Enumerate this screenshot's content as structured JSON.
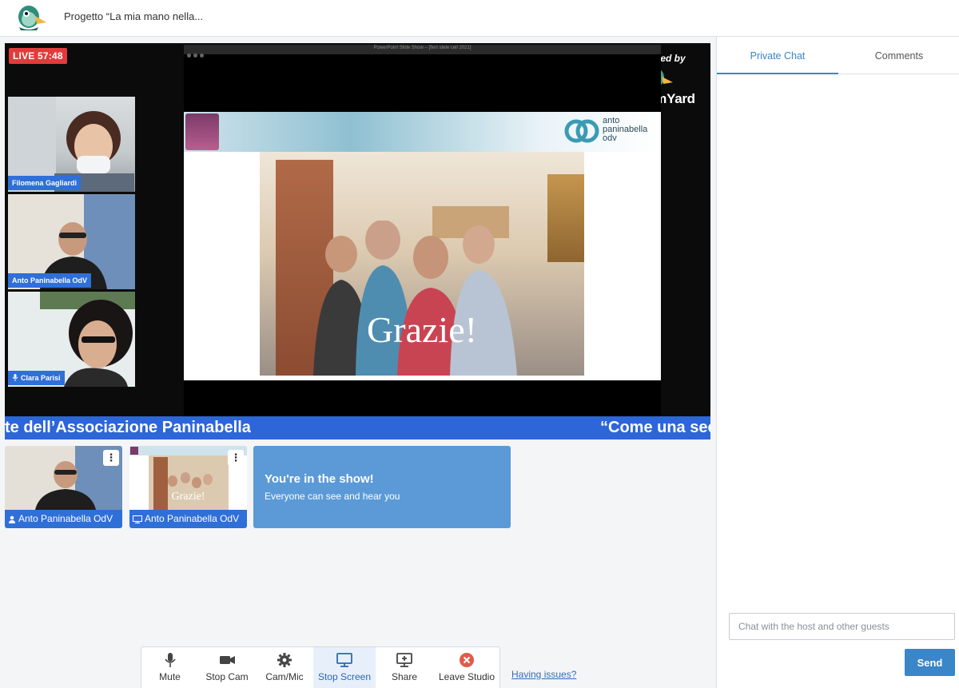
{
  "header": {
    "project_title": "Progetto “La mia mano nella..."
  },
  "stage": {
    "live_badge": "LIVE 57:48",
    "powered_by": "Powered by",
    "brand": "StreamYard",
    "shared_window_title": "PowerPoint Slide Show – [fieri stele cell 2021]",
    "guests": [
      {
        "name": "Filomena Gagliardi"
      },
      {
        "name": "Anto Paninabella OdV"
      },
      {
        "name": "Clara Parisi"
      }
    ],
    "slide": {
      "logo_text": [
        "anto",
        "paninabella",
        "odv"
      ],
      "caption": "Grazie!"
    },
    "ticker": {
      "part1": "te dell’Associazione Paninabella",
      "part2": "“Come una sec"
    }
  },
  "thumbnails": [
    {
      "name": "Anto Paninabella OdV",
      "type": "camera",
      "more_icon": "⋮"
    },
    {
      "name": "Anto Paninabella OdV",
      "type": "screen",
      "more_icon": "⋮",
      "preview_caption": "Grazie!"
    }
  ],
  "show_card": {
    "title": "You're in the show!",
    "subtitle": "Everyone can see and hear you"
  },
  "controls": [
    {
      "label": "Mute",
      "icon": "mic-icon"
    },
    {
      "label": "Stop Cam",
      "icon": "camera-icon"
    },
    {
      "label": "Cam/Mic",
      "icon": "gear-icon"
    },
    {
      "label": "Stop Screen",
      "icon": "monitor-icon",
      "active": true
    },
    {
      "label": "Share",
      "icon": "share-screen-icon"
    },
    {
      "label": "Leave Studio",
      "icon": "close-circle-icon"
    }
  ],
  "having_issues": "Having issues?",
  "chat": {
    "tabs": [
      {
        "label": "Private Chat",
        "active": true
      },
      {
        "label": "Comments",
        "active": false
      }
    ],
    "input_placeholder": "Chat with the host and other guests",
    "send_label": "Send"
  },
  "colors": {
    "accent": "#3a86c8",
    "ticker": "#2d66d8",
    "live": "#e23b3b"
  }
}
